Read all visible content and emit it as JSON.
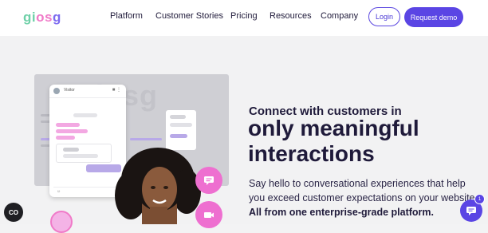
{
  "brand": {
    "logo_text_1": "gi",
    "logo_text_2": "os",
    "logo_text_3": "g"
  },
  "nav": {
    "items": [
      {
        "label": "Platform"
      },
      {
        "label": "Customer Stories"
      },
      {
        "label": "Pricing"
      },
      {
        "label": "Resources"
      },
      {
        "label": "Company"
      }
    ],
    "login_label": "Login",
    "demo_label": "Request demo"
  },
  "hero": {
    "heading_small": "Connect with customers in",
    "heading_large_1": "only meaningful",
    "heading_large_2": "interactions",
    "body_line_1": "Say hello to conversational experiences that help",
    "body_line_2": "you exceed customer expectations on your website.",
    "body_line_3": "All from one enterprise-grade platform."
  },
  "mock_chat": {
    "title": "Visitor"
  },
  "widgets": {
    "cookie_label": "CO",
    "chat_badge_count": "1"
  },
  "colors": {
    "accent": "#5a45e4",
    "pink": "#ee6fd0",
    "text": "#1f1a3a"
  }
}
